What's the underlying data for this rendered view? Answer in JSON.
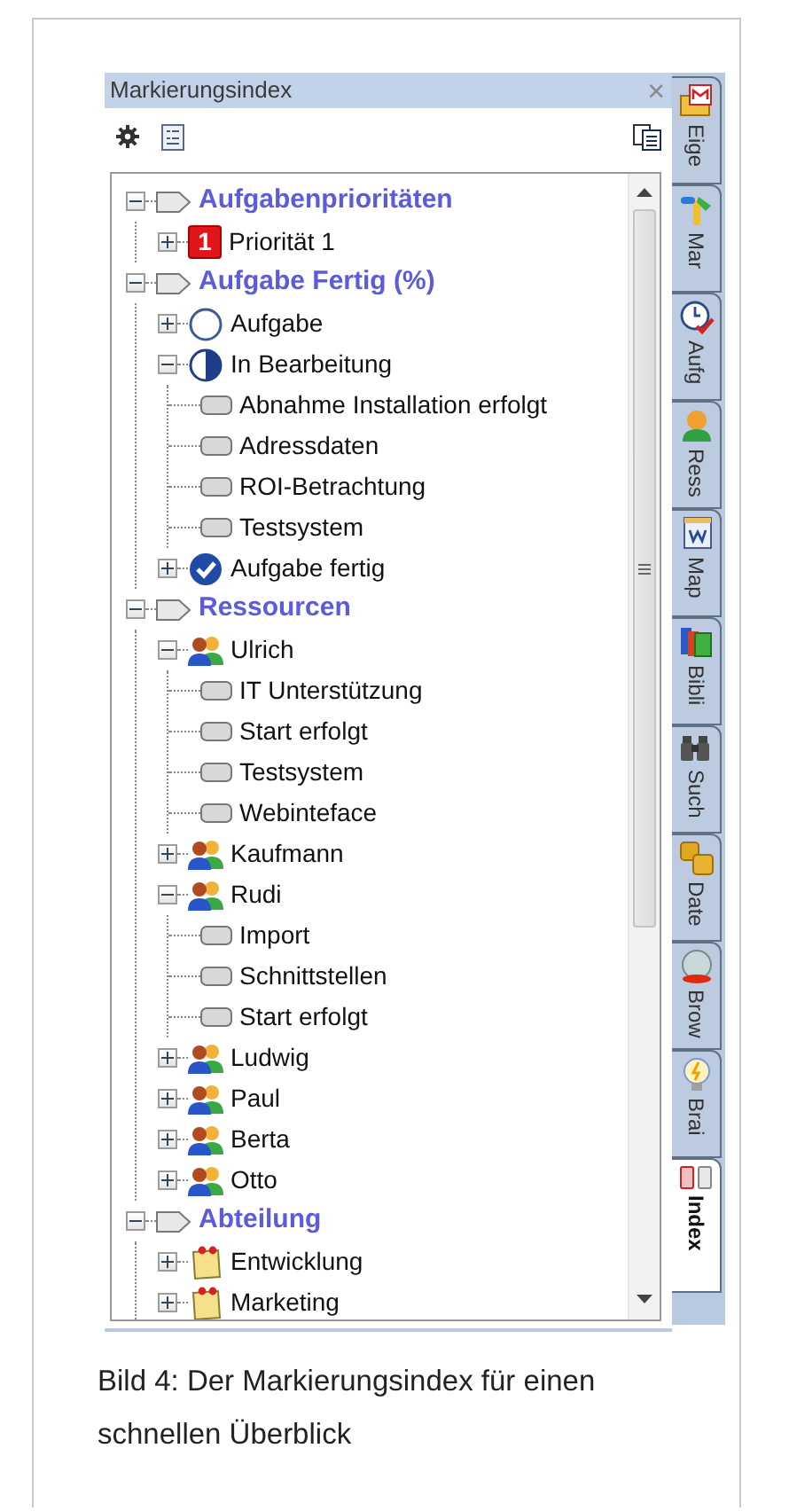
{
  "panel": {
    "title": "Markierungsindex",
    "close": "×"
  },
  "tree": [
    {
      "label": "Aufgabenprioritäten",
      "kind": "category",
      "expanded": true,
      "children": [
        {
          "label": "Priorität 1",
          "kind": "priority",
          "badge": "1",
          "expanded": false
        }
      ]
    },
    {
      "label": "Aufgabe Fertig (%)",
      "kind": "category",
      "expanded": true,
      "children": [
        {
          "label": "Aufgabe",
          "kind": "progress-empty",
          "expanded": false
        },
        {
          "label": "In Bearbeitung",
          "kind": "progress-half",
          "expanded": true,
          "children": [
            {
              "label": "Abnahme Installation erfolgt",
              "kind": "tag"
            },
            {
              "label": "Adressdaten",
              "kind": "tag"
            },
            {
              "label": "ROI-Betrachtung",
              "kind": "tag"
            },
            {
              "label": "Testsystem",
              "kind": "tag"
            }
          ]
        },
        {
          "label": "Aufgabe fertig",
          "kind": "progress-done",
          "expanded": false
        }
      ]
    },
    {
      "label": "Ressourcen",
      "kind": "category",
      "expanded": true,
      "children": [
        {
          "label": "Ulrich",
          "kind": "person",
          "expanded": true,
          "children": [
            {
              "label": "IT Unterstützung",
              "kind": "tag"
            },
            {
              "label": "Start erfolgt",
              "kind": "tag"
            },
            {
              "label": "Testsystem",
              "kind": "tag"
            },
            {
              "label": "Webinteface",
              "kind": "tag"
            }
          ]
        },
        {
          "label": "Kaufmann",
          "kind": "person",
          "expanded": false
        },
        {
          "label": "Rudi",
          "kind": "person",
          "expanded": true,
          "children": [
            {
              "label": "Import",
              "kind": "tag"
            },
            {
              "label": "Schnittstellen",
              "kind": "tag"
            },
            {
              "label": "Start erfolgt",
              "kind": "tag"
            }
          ]
        },
        {
          "label": "Ludwig",
          "kind": "person",
          "expanded": false
        },
        {
          "label": "Paul",
          "kind": "person",
          "expanded": false
        },
        {
          "label": "Berta",
          "kind": "person",
          "expanded": false
        },
        {
          "label": "Otto",
          "kind": "person",
          "expanded": false
        }
      ]
    },
    {
      "label": "Abteilung",
      "kind": "category",
      "expanded": true,
      "children": [
        {
          "label": "Entwicklung",
          "kind": "note",
          "expanded": false
        },
        {
          "label": "Marketing",
          "kind": "note",
          "expanded": false
        }
      ]
    }
  ],
  "side_tabs": [
    {
      "label": "Eige",
      "kind": "mail",
      "selected": false
    },
    {
      "label": "Mar",
      "kind": "marker",
      "selected": false
    },
    {
      "label": "Aufg",
      "kind": "clock",
      "selected": false
    },
    {
      "label": "Ress",
      "kind": "person",
      "selected": false
    },
    {
      "label": "Map",
      "kind": "map",
      "selected": false
    },
    {
      "label": "Bibli",
      "kind": "books",
      "selected": false
    },
    {
      "label": "Such",
      "kind": "binoculars",
      "selected": false
    },
    {
      "label": "Date",
      "kind": "cubes",
      "selected": false
    },
    {
      "label": "Brow",
      "kind": "globe",
      "selected": false
    },
    {
      "label": "Brai",
      "kind": "bulb",
      "selected": false
    },
    {
      "label": "Index",
      "kind": "tags",
      "selected": true
    }
  ],
  "caption": "Bild 4: Der Markierungsindex für einen schnellen Überblick"
}
